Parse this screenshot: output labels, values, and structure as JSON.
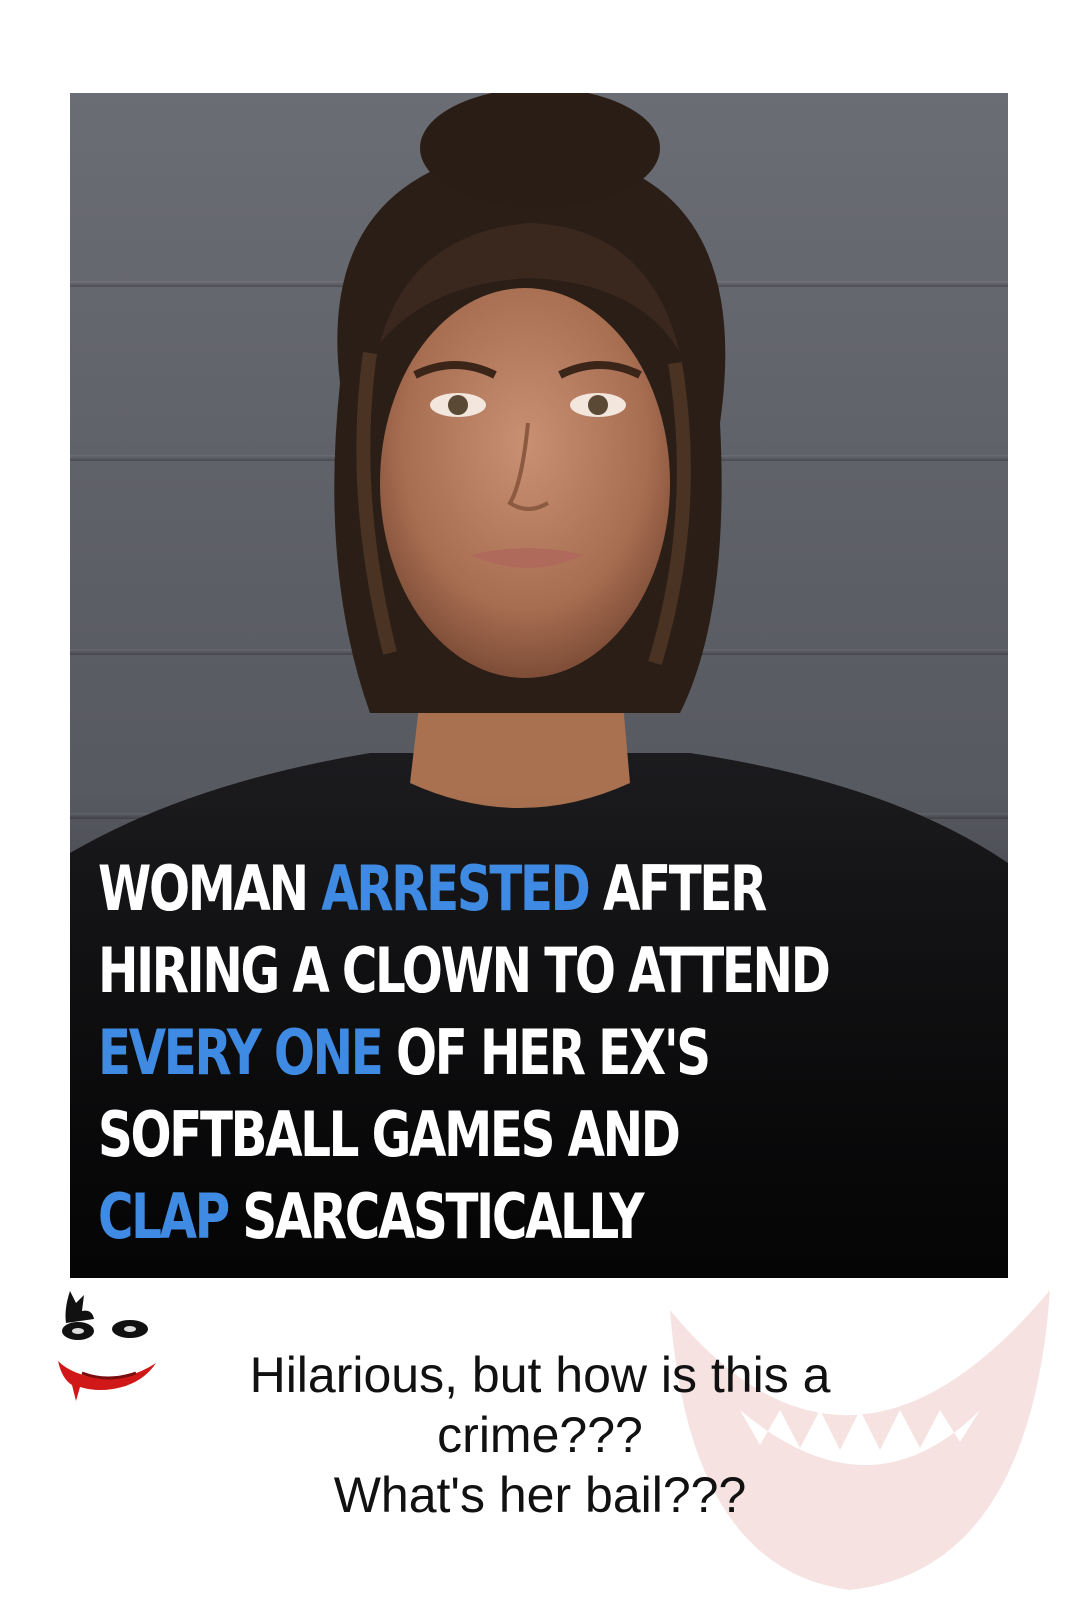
{
  "headline": {
    "line1": {
      "w1": "WOMAN ",
      "hl": "ARRESTED",
      "w2": " AFTER"
    },
    "line2": {
      "text": "HIRING A CLOWN TO ATTEND"
    },
    "line3": {
      "hl": "EVERY ONE",
      "w2": " OF HER EX'S"
    },
    "line4": {
      "text": "SOFTBALL GAMES AND"
    },
    "line5": {
      "hl": "CLAP",
      "w2": " SARCASTICALLY"
    },
    "highlight_color": "#3f8be3",
    "text_color": "#ffffff"
  },
  "caption": {
    "line1": "Hilarious, but how is this a",
    "line2": "crime???",
    "line3": "What's her bail???"
  },
  "icons": {
    "caption_icon": "joker-face-icon",
    "watermark": "joker-smile-icon"
  }
}
